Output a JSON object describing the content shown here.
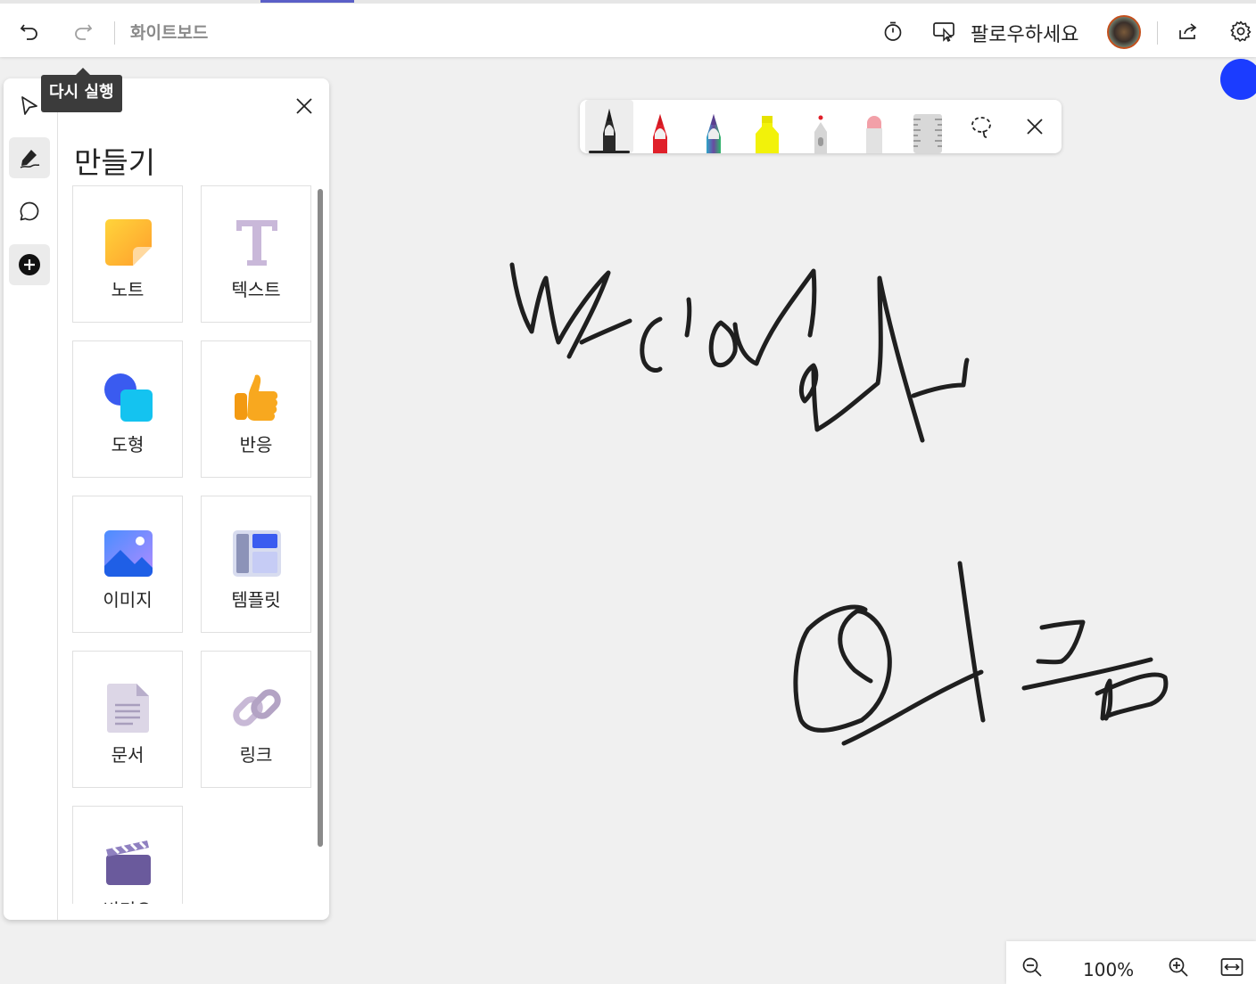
{
  "app": {
    "title": "화이트보드",
    "tooltip": "다시 실행",
    "follow_label": "팔로우하세요"
  },
  "toolbar": {
    "undo_icon": "undo-icon",
    "redo_icon": "redo-icon",
    "timer_icon": "timer-icon",
    "follow_icon": "present-follow-icon",
    "share_icon": "share-icon",
    "settings_icon": "gear-icon"
  },
  "panel": {
    "title": "만들기",
    "tiles": [
      {
        "label": "노트",
        "icon": "sticky-note-icon"
      },
      {
        "label": "텍스트",
        "icon": "text-icon"
      },
      {
        "label": "도형",
        "icon": "shapes-icon"
      },
      {
        "label": "반응",
        "icon": "thumbs-up-icon"
      },
      {
        "label": "이미지",
        "icon": "image-icon"
      },
      {
        "label": "템플릿",
        "icon": "template-icon"
      },
      {
        "label": "문서",
        "icon": "document-icon"
      },
      {
        "label": "링크",
        "icon": "link-icon"
      },
      {
        "label": "비디오",
        "icon": "video-icon"
      }
    ]
  },
  "pens": [
    {
      "name": "black-pen",
      "color": "#1a1a1a"
    },
    {
      "name": "red-pen",
      "color": "#e0202a"
    },
    {
      "name": "rainbow-pen",
      "color": "#6a4aa0"
    },
    {
      "name": "highlighter",
      "color": "#f2f20a"
    },
    {
      "name": "laser-pointer",
      "color": "#e0202a"
    },
    {
      "name": "eraser",
      "color": "#f2a0a8"
    },
    {
      "name": "ruler",
      "color": "#d6d6d6"
    }
  ],
  "zoom": {
    "value": "100%"
  },
  "colors": {
    "accent": "#5b5fc7",
    "ink": "#1f1f1f",
    "blue_dot": "#1b3cff"
  }
}
